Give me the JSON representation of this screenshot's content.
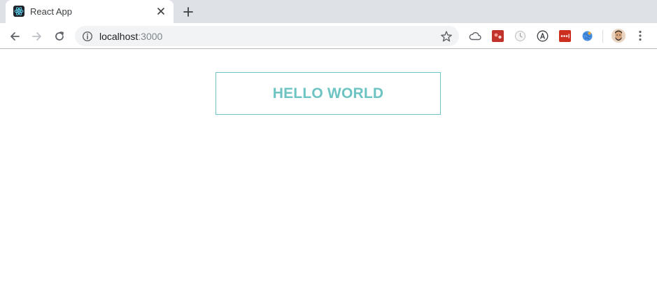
{
  "tab": {
    "title": "React App",
    "favicon": "react-logo-icon",
    "close_icon": "close-icon"
  },
  "new_tab_icon": "plus-icon",
  "toolbar": {
    "back_icon": "arrow-left-icon",
    "forward_icon": "arrow-right-icon",
    "reload_icon": "reload-icon",
    "url_host": "localhost",
    "url_port": ":3000",
    "site_info_icon": "info-icon",
    "bookmark_icon": "star-icon",
    "extensions": [
      "cloud-icon",
      "extension-red-icon",
      "extension-clock-icon",
      "extension-a-icon",
      "extension-lastpass-icon",
      "extension-globe-icon"
    ],
    "profile_icon": "avatar-icon",
    "menu_icon": "kebab-menu-icon"
  },
  "colors": {
    "accent": "#6ec3c3",
    "tabstrip": "#dee1e6",
    "omnibox": "#f1f3f4"
  },
  "page": {
    "heading": "HELLO WORLD"
  }
}
